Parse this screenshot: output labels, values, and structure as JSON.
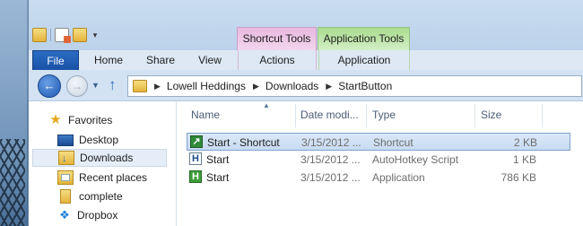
{
  "window": {
    "contextual_groups": [
      {
        "label": "Shortcut Tools",
        "color": "#f3d6ee"
      },
      {
        "label": "Application Tools",
        "color": "#d5efc8"
      }
    ]
  },
  "ribbon": {
    "tabs": {
      "file": "File",
      "home": "Home",
      "share": "Share",
      "view": "View",
      "actions": "Actions",
      "application": "Application"
    }
  },
  "address": {
    "crumbs": [
      "Lowell Heddings",
      "Downloads",
      "StartButton"
    ]
  },
  "navigation": {
    "favorites": "Favorites",
    "items": [
      {
        "label": "Desktop",
        "icon": "desktop-icon"
      },
      {
        "label": "Downloads",
        "icon": "downloads-folder-icon"
      },
      {
        "label": "Recent places",
        "icon": "recent-places-icon"
      },
      {
        "label": "complete",
        "icon": "folder-icon"
      },
      {
        "label": "Dropbox",
        "icon": "dropbox-icon"
      }
    ]
  },
  "files": {
    "columns": {
      "name": "Name",
      "date": "Date modi...",
      "type": "Type",
      "size": "Size"
    },
    "rows": [
      {
        "name": "Start - Shortcut",
        "date": "3/15/2012 ...",
        "type": "Shortcut",
        "size": "2 KB",
        "icon": "shortcut-icon"
      },
      {
        "name": "Start",
        "date": "3/15/2012 ...",
        "type": "AutoHotkey Script",
        "size": "1 KB",
        "icon": "autohotkey-script-icon"
      },
      {
        "name": "Start",
        "date": "3/15/2012 ...",
        "type": "Application",
        "size": "786 KB",
        "icon": "application-icon"
      }
    ]
  }
}
